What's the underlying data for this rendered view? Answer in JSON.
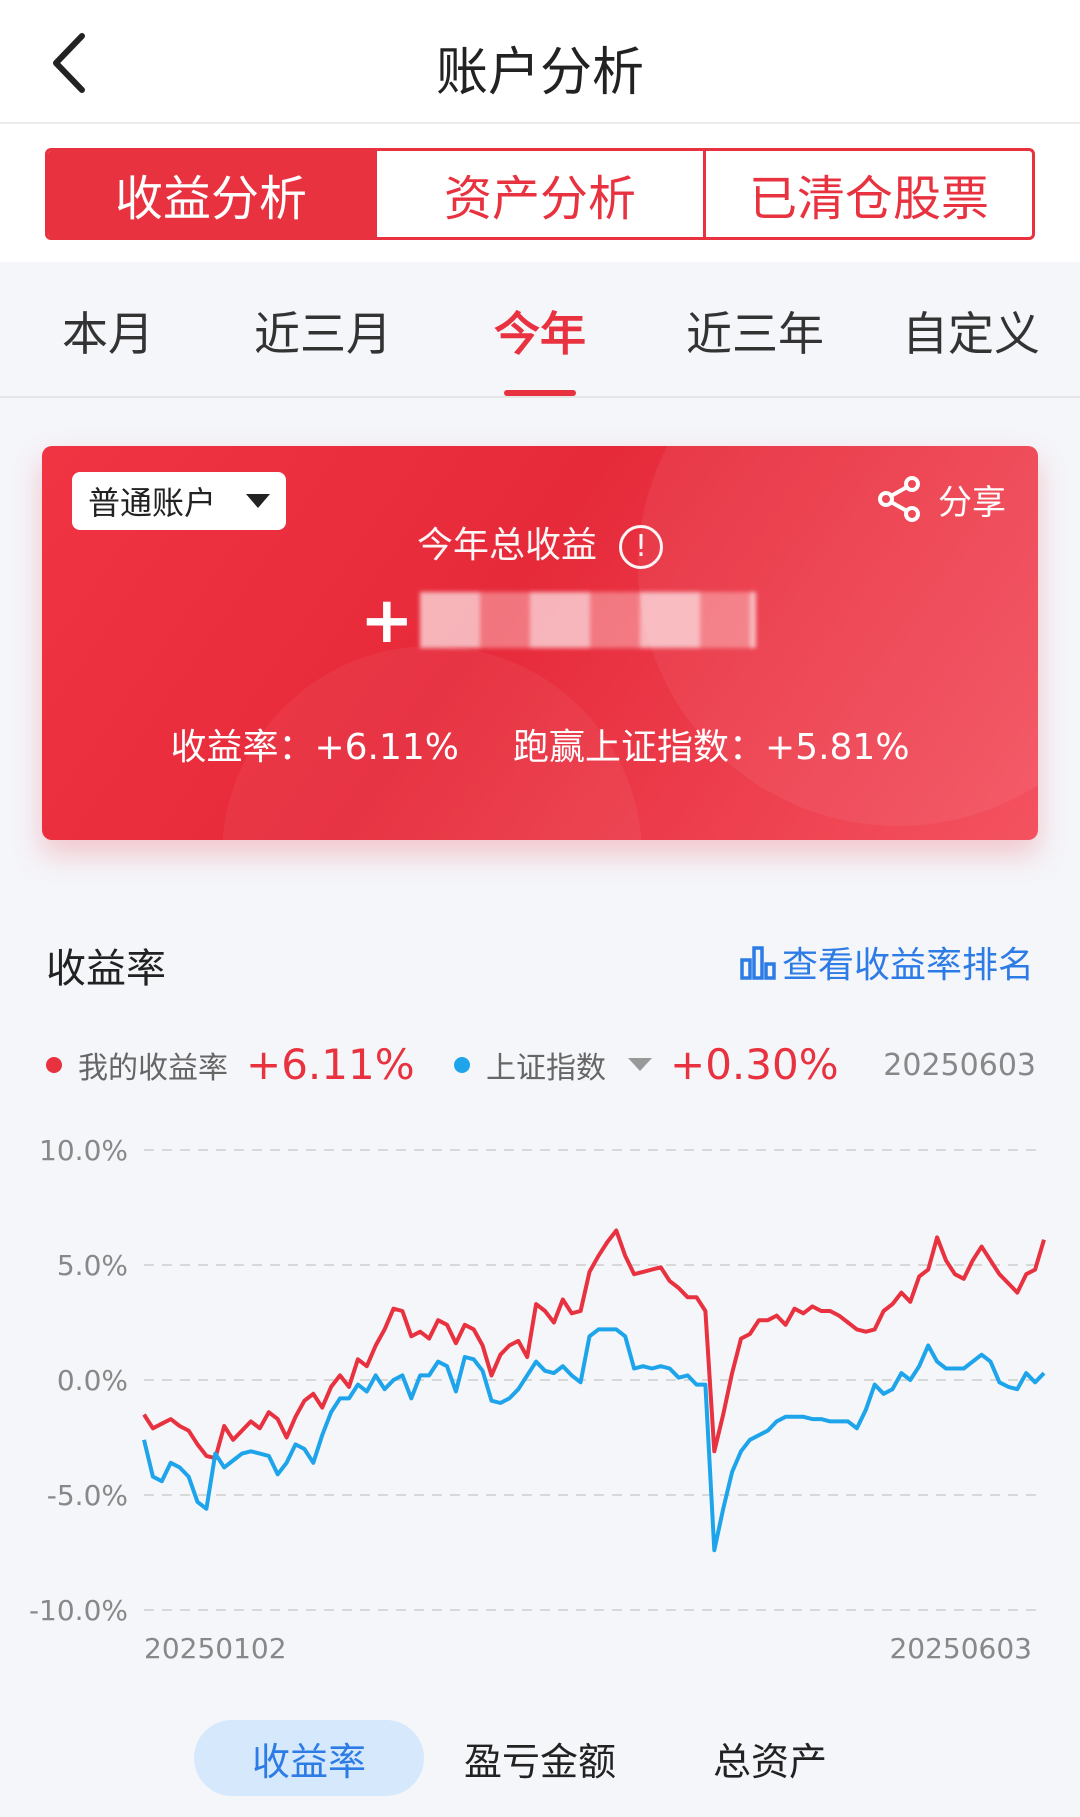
{
  "nav": {
    "title": "账户分析"
  },
  "segments": [
    {
      "label": "收益分析",
      "active": true
    },
    {
      "label": "资产分析",
      "active": false
    },
    {
      "label": "已清仓股票",
      "active": false
    }
  ],
  "periods": [
    {
      "label": "本月",
      "active": false
    },
    {
      "label": "近三月",
      "active": false
    },
    {
      "label": "今年",
      "active": true
    },
    {
      "label": "近三年",
      "active": false
    },
    {
      "label": "自定义",
      "active": false
    }
  ],
  "card": {
    "account": "普通账户",
    "share_label": "分享",
    "total_label": "今年总收益",
    "info_glyph": "!",
    "plus_sign": "+",
    "return_rate_text": "收益率：+6.11%",
    "beat_index_text": "跑赢上证指数：+5.81%"
  },
  "section": {
    "title": "收益率",
    "rank_link": "查看收益率排名"
  },
  "legend": {
    "mine_label": "我的收益率",
    "mine_value": "+6.11%",
    "index_label": "上证指数",
    "index_value": "+0.30%",
    "date": "20250603"
  },
  "colors": {
    "accent": "#e8323f",
    "index_line": "#1ea4ea",
    "link": "#2d7be5"
  },
  "chart_data": {
    "type": "line",
    "title": "",
    "xlabel": "",
    "ylabel": "",
    "ylim": [
      -10,
      10
    ],
    "yticks": [
      10,
      5,
      0,
      -5,
      -10
    ],
    "ytick_labels": [
      "10.0%",
      "5.0%",
      "0.0%",
      "-5.0%",
      "-10.0%"
    ],
    "x_start_label": "20250102",
    "x_end_label": "20250603",
    "grid": true,
    "series": [
      {
        "name": "我的收益率",
        "color": "#e8323f",
        "values": [
          -1.5,
          -2.1,
          -1.9,
          -1.7,
          -2.0,
          -2.2,
          -2.8,
          -3.3,
          -3.4,
          -2.0,
          -2.6,
          -2.2,
          -1.8,
          -2.1,
          -1.4,
          -1.7,
          -2.5,
          -1.6,
          -0.9,
          -0.6,
          -1.2,
          -0.3,
          0.2,
          -0.3,
          0.9,
          0.6,
          1.5,
          2.2,
          3.1,
          3.0,
          1.9,
          2.1,
          1.8,
          2.6,
          2.4,
          1.6,
          2.4,
          2.2,
          1.5,
          0.2,
          1.1,
          1.5,
          1.7,
          1.0,
          3.3,
          3.0,
          2.5,
          3.5,
          2.9,
          3.0,
          4.7,
          5.4,
          6.0,
          6.5,
          5.4,
          4.6,
          4.7,
          4.8,
          4.9,
          4.3,
          4.0,
          3.6,
          3.6,
          3.0,
          -3.1,
          -1.5,
          0.3,
          1.8,
          2.0,
          2.6,
          2.6,
          2.8,
          2.4,
          3.1,
          2.9,
          3.2,
          3.0,
          3.0,
          2.8,
          2.5,
          2.2,
          2.1,
          2.2,
          3.0,
          3.3,
          3.8,
          3.4,
          4.5,
          4.8,
          6.2,
          5.2,
          4.6,
          4.4,
          5.2,
          5.8,
          5.2,
          4.6,
          4.2,
          3.8,
          4.6,
          4.8,
          6.1
        ]
      },
      {
        "name": "上证指数",
        "color": "#1ea4ea",
        "values": [
          -2.6,
          -4.2,
          -4.4,
          -3.6,
          -3.8,
          -4.2,
          -5.3,
          -5.6,
          -3.2,
          -3.8,
          -3.5,
          -3.2,
          -3.1,
          -3.2,
          -3.3,
          -4.1,
          -3.6,
          -2.8,
          -3.0,
          -3.6,
          -2.4,
          -1.4,
          -0.8,
          -0.8,
          -0.2,
          -0.5,
          0.2,
          -0.4,
          0.0,
          0.2,
          -0.8,
          0.2,
          0.2,
          0.8,
          0.6,
          -0.5,
          1.0,
          0.9,
          0.4,
          -0.9,
          -1.0,
          -0.8,
          -0.4,
          0.2,
          0.8,
          0.4,
          0.3,
          0.6,
          0.2,
          -0.1,
          1.9,
          2.2,
          2.2,
          2.2,
          1.9,
          0.5,
          0.6,
          0.5,
          0.6,
          0.5,
          0.1,
          0.2,
          -0.2,
          -0.2,
          -7.4,
          -5.6,
          -4.0,
          -3.1,
          -2.6,
          -2.4,
          -2.2,
          -1.8,
          -1.6,
          -1.6,
          -1.6,
          -1.7,
          -1.7,
          -1.8,
          -1.8,
          -1.8,
          -2.1,
          -1.3,
          -0.2,
          -0.6,
          -0.4,
          0.3,
          0.0,
          0.6,
          1.5,
          0.8,
          0.5,
          0.5,
          0.5,
          0.8,
          1.1,
          0.8,
          -0.1,
          -0.3,
          -0.4,
          0.3,
          -0.1,
          0.3
        ]
      }
    ]
  },
  "bottom_tabs": [
    {
      "label": "收益率",
      "active": true
    },
    {
      "label": "盈亏金额",
      "active": false
    },
    {
      "label": "总资产",
      "active": false
    }
  ]
}
